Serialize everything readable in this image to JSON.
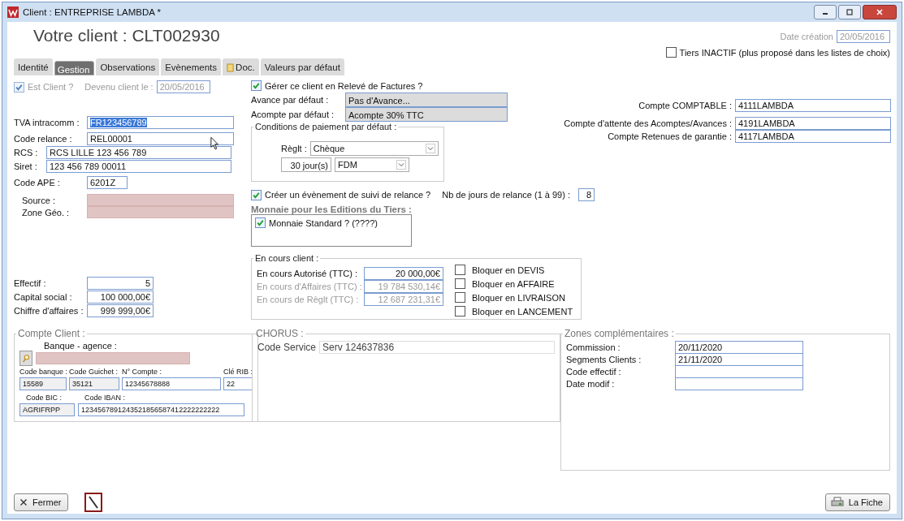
{
  "window": {
    "title": "Client : ENTREPRISE LAMBDA *"
  },
  "heading": "Votre client : CLT002930",
  "date_creation": {
    "label": "Date création",
    "value": "20/05/2016"
  },
  "inactive": {
    "label": "Tiers INACTIF (plus proposé dans les listes de choix)",
    "checked": false
  },
  "tabs": [
    {
      "label": "Identité",
      "selected": false,
      "has_icon": false
    },
    {
      "label": "Gestion",
      "selected": true,
      "has_icon": false
    },
    {
      "label": "Observations",
      "selected": false,
      "has_icon": false
    },
    {
      "label": "Evènements",
      "selected": false,
      "has_icon": false
    },
    {
      "label": "Doc.",
      "selected": false,
      "has_icon": true
    },
    {
      "label": "Valeurs par défaut",
      "selected": false,
      "has_icon": false
    }
  ],
  "est_client": {
    "label": "Est Client ?",
    "checked": true,
    "disabled": true,
    "since_label": "Devenu client le :",
    "since_value": "20/05/2016"
  },
  "identity_fields": [
    {
      "label": "TVA intracomm :",
      "value": "FR123456789",
      "highlighted": true
    },
    {
      "label": "Code relance :",
      "value": "REL00001",
      "highlighted": false
    },
    {
      "label": "RCS :",
      "value": "RCS LILLE 123 456 789",
      "highlighted": false
    },
    {
      "label": "Siret :",
      "value": "123 456 789 00011",
      "highlighted": false
    },
    {
      "label": "Code APE :",
      "value": "6201Z",
      "highlighted": false
    }
  ],
  "lookups": [
    {
      "label": "Source :"
    },
    {
      "label": "Zone Géo. :"
    }
  ],
  "figures": [
    {
      "label": "Effectif :",
      "value": "5"
    },
    {
      "label": "Capital social :",
      "value": "100 000,00€"
    },
    {
      "label": "Chiffre d'affaires :",
      "value": "999 999,00€"
    }
  ],
  "releve": {
    "label": "Gérer ce client en Relevé de Factures ?",
    "checked": true
  },
  "defaults": [
    {
      "label": "Avance par défaut :",
      "value": "Pas d'Avance..."
    },
    {
      "label": "Acompte par défaut :",
      "value": "Acompte 30% TTC"
    }
  ],
  "conditions": {
    "title": "Conditions de paiement par défaut :",
    "reglt_label": "Règlt :",
    "reglt_value": "Chèque",
    "days": "30 jour(s)",
    "term": "FDM"
  },
  "relance": {
    "label": "Créer un évènement de suivi de relance ?",
    "checked": true,
    "days_label": "Nb de jours de relance (1 à 99) :",
    "days_value": "8"
  },
  "monnaie": {
    "title": "Monnaie pour les Editions du Tiers :",
    "label": "Monnaie Standard ? (????)",
    "checked": true
  },
  "encours": {
    "title": "En cours client :",
    "rows": [
      {
        "label": "En cours Autorisé (TTC) :",
        "value": "20 000,00€",
        "disabled": false
      },
      {
        "label": "En cours d'Affaires (TTC) :",
        "value": "19 784 530,14€",
        "disabled": true
      },
      {
        "label": "En cours de Règlt (TTC) :",
        "value": "12 687 231,31€",
        "disabled": true
      }
    ],
    "blocks": [
      {
        "label": "Bloquer en DEVIS",
        "checked": false
      },
      {
        "label": "Bloquer en AFFAIRE",
        "checked": false
      },
      {
        "label": "Bloquer en LIVRAISON",
        "checked": false
      },
      {
        "label": "Bloquer en LANCEMENT",
        "checked": false
      }
    ]
  },
  "comptes": [
    {
      "label": "Compte COMPTABLE :",
      "value": "4111LAMBDA"
    },
    {
      "label": "Compte d'attente des Acomptes/Avances :",
      "value": "4191LAMBDA"
    },
    {
      "label": "Compte Retenues de garantie :",
      "value": "4117LAMBDA"
    }
  ],
  "compte_client": {
    "title": "Compte Client :",
    "bank_label": "Banque - agence :",
    "rib": [
      {
        "label": "Code banque :",
        "value": "15589",
        "readonly": true
      },
      {
        "label": "Code Guichet :",
        "value": "35121",
        "readonly": true
      },
      {
        "label": "N° Compte :",
        "value": "12345678888",
        "readonly": false
      },
      {
        "label": "Clé RIB :",
        "value": "22",
        "readonly": false
      }
    ],
    "bic": {
      "label": "Code BIC :",
      "value": "AGRIFRPP"
    },
    "iban": {
      "label": "Code IBAN :",
      "value": "1234567891243521856587412222222222"
    }
  },
  "chorus": {
    "title": "CHORUS :",
    "label": "Code Service",
    "value": "Serv 124637836"
  },
  "zones": {
    "title": "Zones complémentaires :",
    "rows": [
      {
        "label": "Commission :",
        "value": "20/11/2020"
      },
      {
        "label": "Segments Clients :",
        "value": "21/11/2020"
      },
      {
        "label": "Code effectif :",
        "value": ""
      },
      {
        "label": "Date modif :",
        "value": ""
      }
    ]
  },
  "buttons": {
    "close": "Fermer",
    "print": "La Fiche"
  }
}
